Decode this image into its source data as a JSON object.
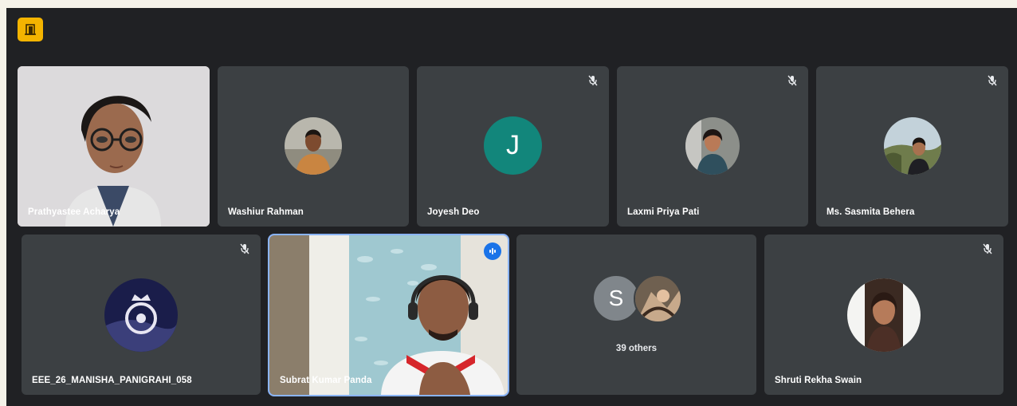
{
  "participants_row1": [
    {
      "name": "Prathyastee Acharya"
    },
    {
      "name": "Washiur Rahman"
    },
    {
      "name": "Joyesh Deo",
      "initial": "J"
    },
    {
      "name": "Laxmi Priya Pati"
    },
    {
      "name": "Ms. Sasmita Behera"
    }
  ],
  "participants_row2": [
    {
      "name": "EEE_26_MANISHA_PANIGRAHI_058"
    },
    {
      "name": "Subrat Kumar Panda"
    },
    {
      "initial": "S",
      "others_label": "39 others"
    },
    {
      "name": "Shruti Rekha Swain"
    }
  ],
  "icons": {
    "meeting_badge": "door-icon",
    "muted": "mic-off-icon",
    "speaking": "audio-level-icon"
  },
  "colors": {
    "joyesh_avatar": "#12867b",
    "others_avatar": "#80868b",
    "badge": "#f4b400",
    "speaking_border": "#8ab4f8"
  }
}
